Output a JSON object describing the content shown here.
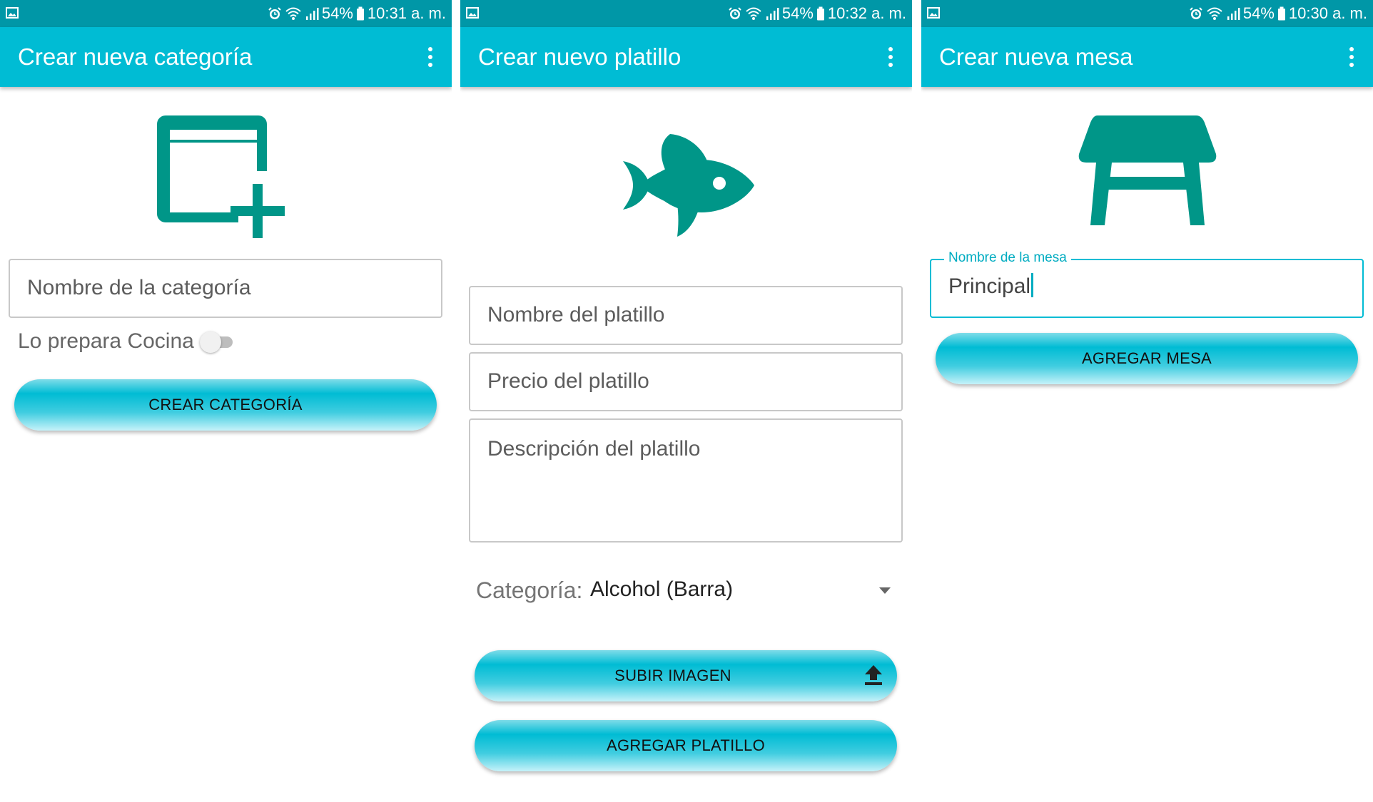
{
  "screens": [
    {
      "status": {
        "battery": "54%",
        "time": "10:31 a. m."
      },
      "title": "Crear nueva categoría",
      "fields": {
        "nombre_placeholder": "Nombre de la categoría"
      },
      "toggle": {
        "label": "Lo prepara Cocina",
        "on": false
      },
      "button": "CREAR CATEGORÍA",
      "hero_icon": "add-card-icon"
    },
    {
      "status": {
        "battery": "54%",
        "time": "10:32 a. m."
      },
      "title": "Crear nuevo platillo",
      "fields": {
        "nombre_placeholder": "Nombre del platillo",
        "precio_placeholder": "Precio del platillo",
        "descripcion_placeholder": "Descripción del platillo"
      },
      "category": {
        "label": "Categoría:",
        "selected": "Alcohol (Barra)"
      },
      "buttons": {
        "upload": "SUBIR IMAGEN",
        "add": "AGREGAR PLATILLO"
      },
      "hero_icon": "fish-icon"
    },
    {
      "status": {
        "battery": "54%",
        "time": "10:30 a. m."
      },
      "title": "Crear nueva mesa",
      "fields": {
        "nombre_label": "Nombre de la mesa",
        "nombre_value": "Principal"
      },
      "button": "AGREGAR MESA",
      "hero_icon": "table-icon"
    }
  ],
  "colors": {
    "status_bar": "#0097a7",
    "app_bar": "#00bcd4",
    "icon": "#009688",
    "accent": "#00acc1"
  }
}
